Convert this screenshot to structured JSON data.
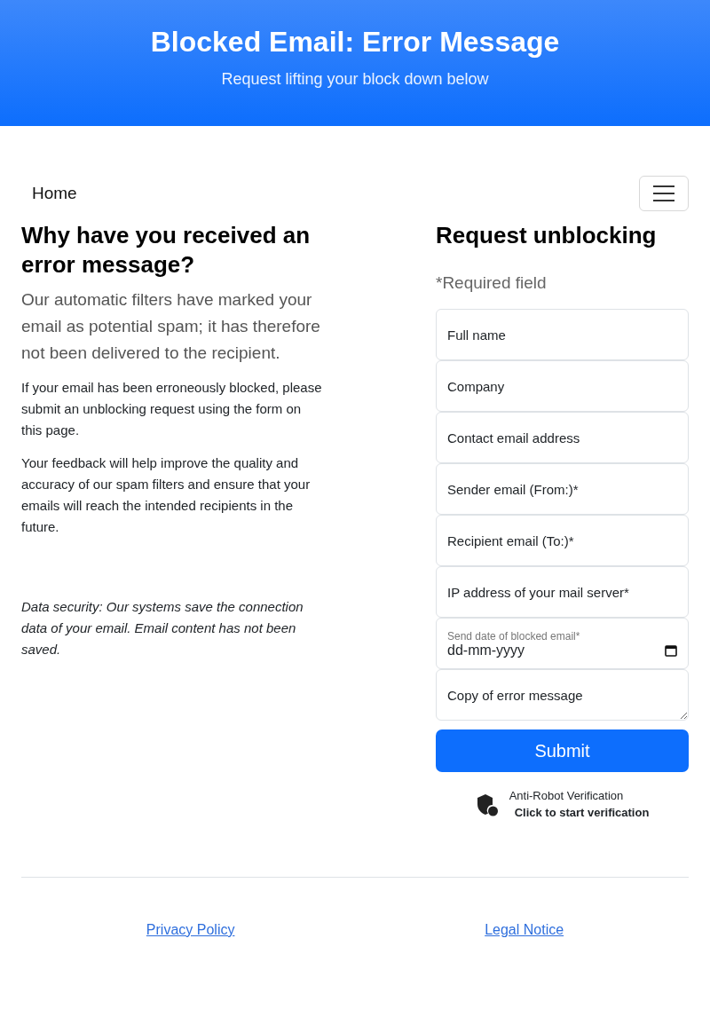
{
  "header": {
    "title": "Blocked Email: Error Message",
    "subtitle": "Request lifting your block down below"
  },
  "nav": {
    "home": "Home"
  },
  "info": {
    "heading": "Why have you received an error message?",
    "lead": "Our automatic filters have marked your email as potential spam; it has therefore not been delivered to the recipient.",
    "paragraphs": [
      "If your email has been erroneously blocked, please submit an unblocking request using the form on this page.",
      "Your feedback will help improve the quality and accuracy of our spam filters and ensure that your emails will reach the intended recipients in the future."
    ],
    "note": "Data security: Our systems save the connection data of your email. Email content has not been saved."
  },
  "form": {
    "heading": "Request unblocking",
    "required_note": "*Required field",
    "fields": [
      {
        "kind": "text",
        "placeholder": "Full name"
      },
      {
        "kind": "text",
        "placeholder": "Company"
      },
      {
        "kind": "text",
        "placeholder": "Contact email address"
      },
      {
        "kind": "text",
        "placeholder": "Sender email (From:)*"
      },
      {
        "kind": "text",
        "placeholder": "Recipient email (To:)*"
      },
      {
        "kind": "text",
        "placeholder": "IP address of your mail server*"
      },
      {
        "kind": "date",
        "label": "Send date of blocked email*",
        "placeholder": "dd-mm-yyyy"
      },
      {
        "kind": "textarea",
        "placeholder": "Copy of error message"
      }
    ],
    "submit": "Submit",
    "captcha": {
      "title": "Anti-Robot Verification",
      "action": "Click to start verification"
    }
  },
  "footer": {
    "links": [
      "Privacy Policy",
      "Legal Notice"
    ]
  }
}
